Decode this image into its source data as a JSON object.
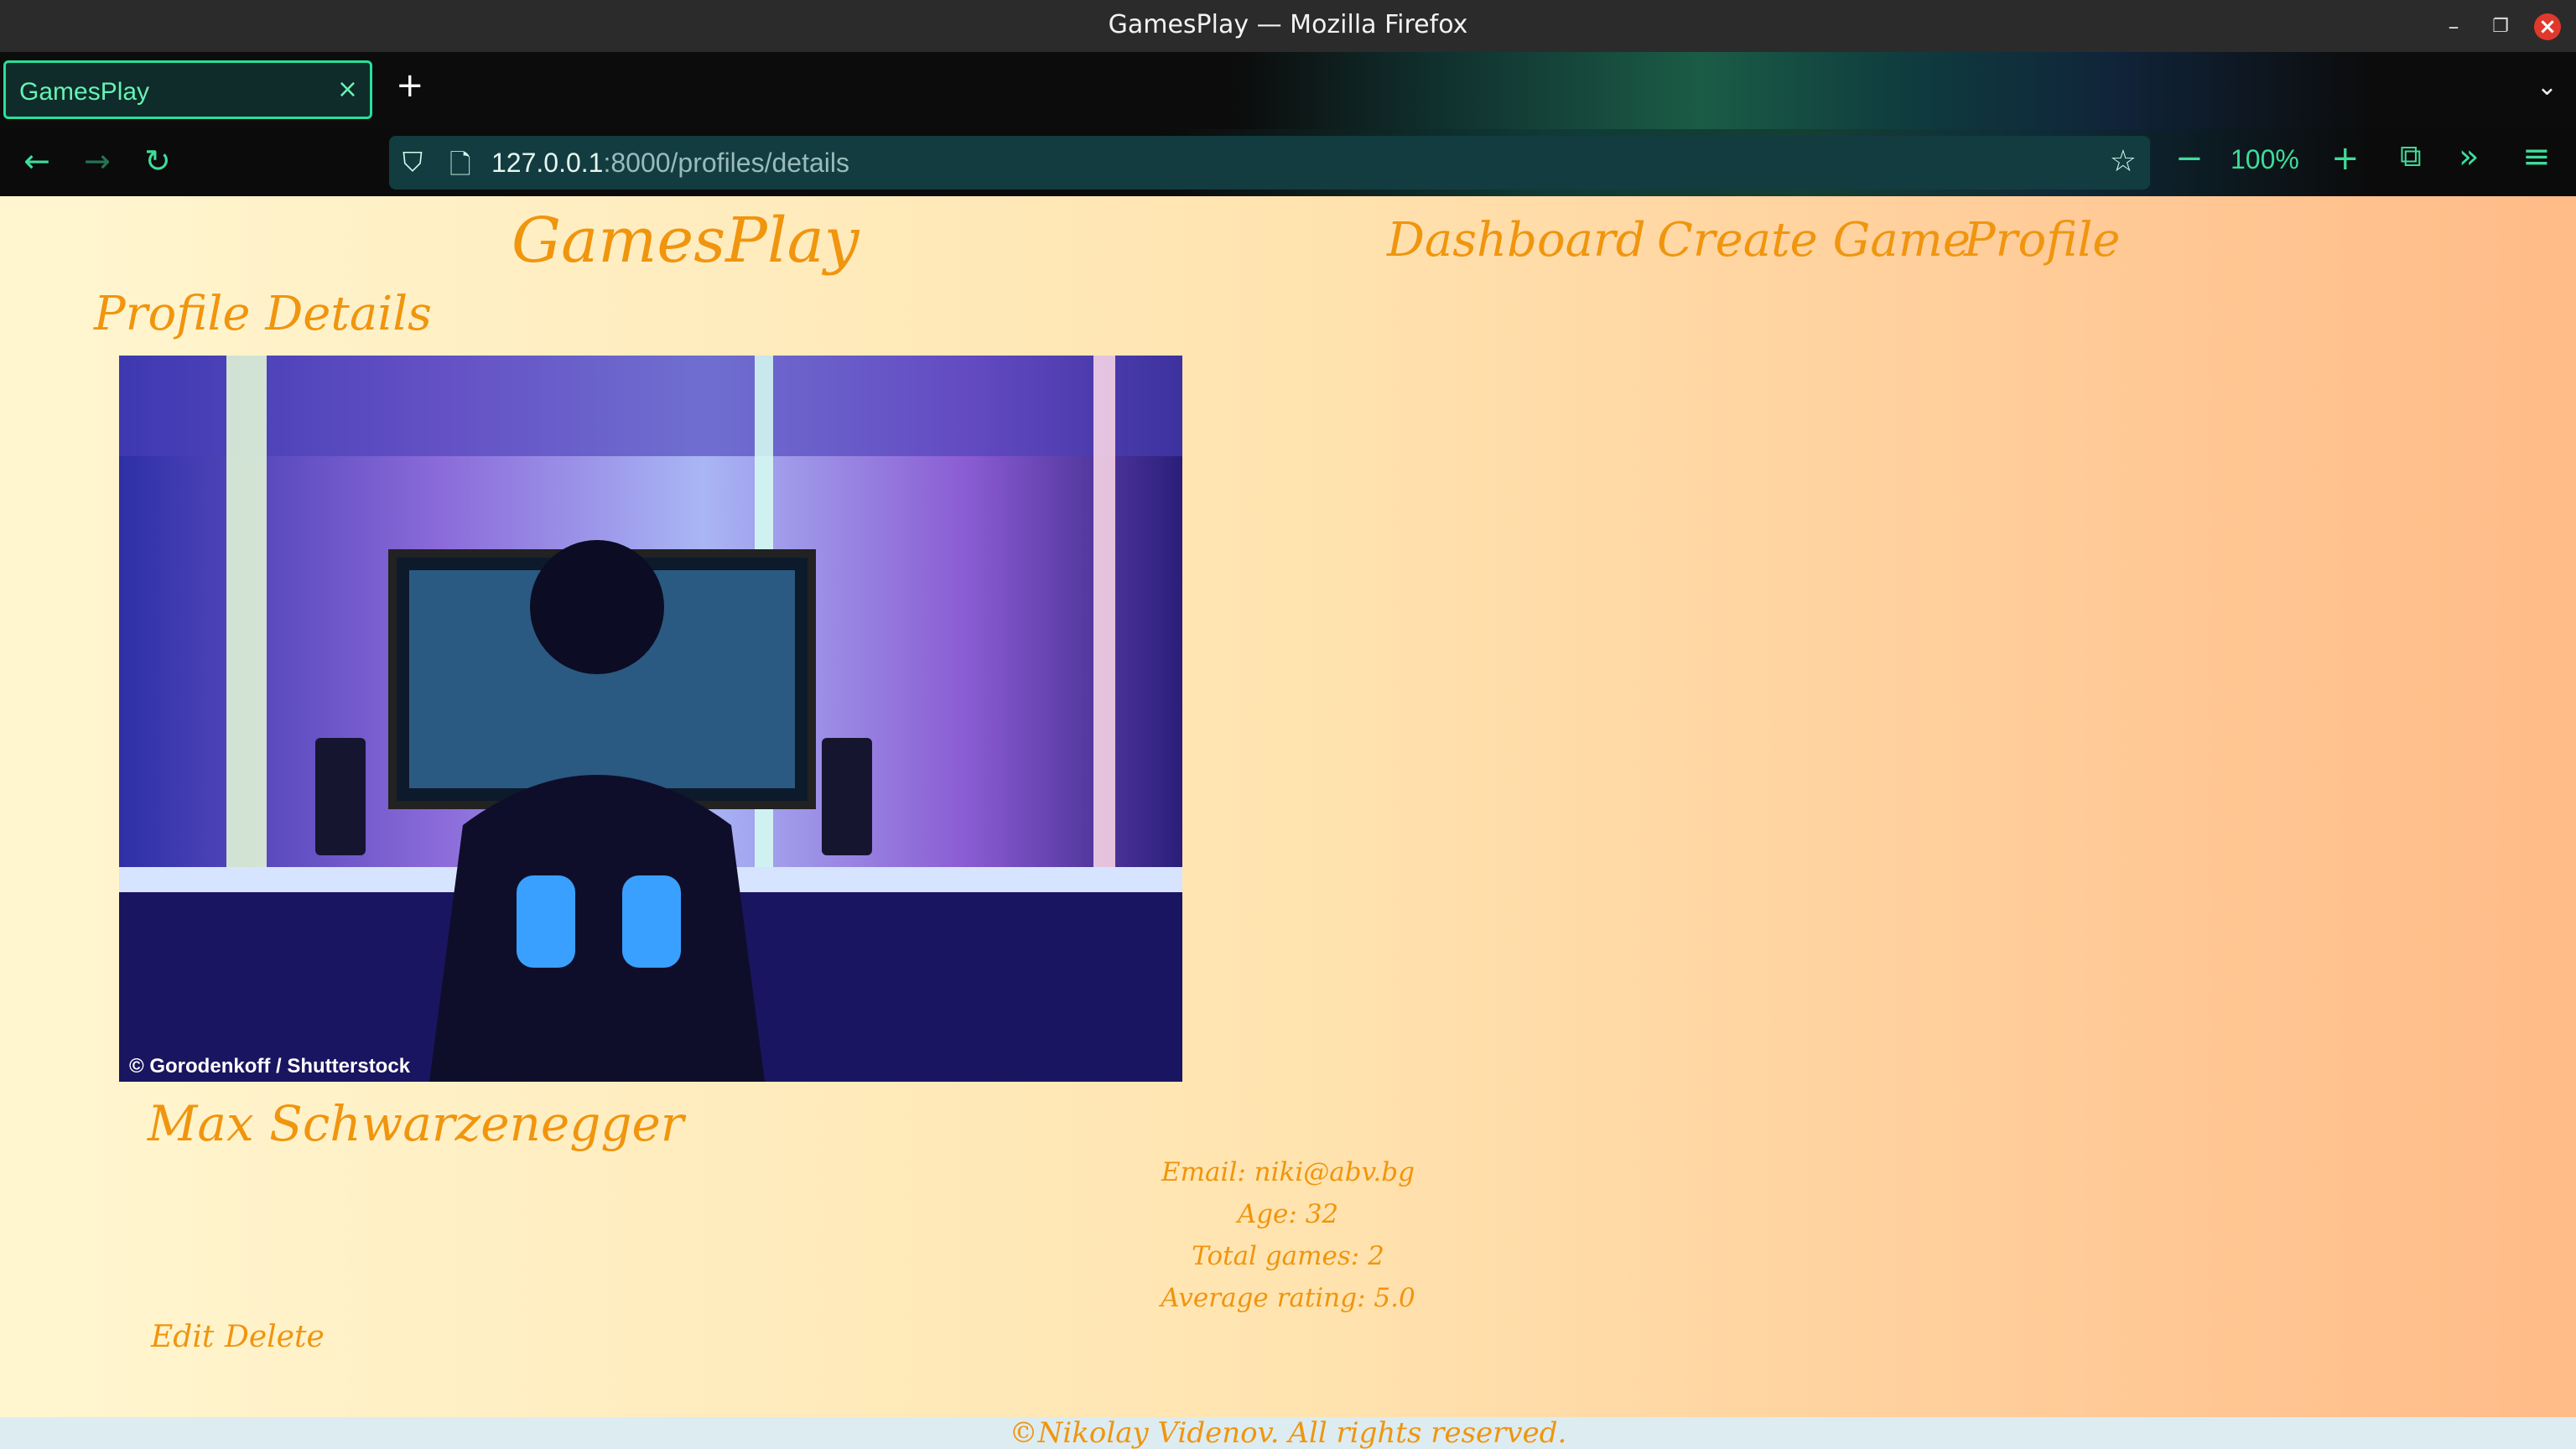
{
  "window": {
    "title": "GamesPlay — Mozilla Firefox"
  },
  "browser": {
    "tab_label": "GamesPlay",
    "url_host": "127.0.0.1",
    "url_path": ":8000/profiles/details",
    "zoom": "100%"
  },
  "site": {
    "logo": "GamesPlay",
    "nav": {
      "dashboard": "Dashboard",
      "create_game": "Create Game",
      "profile": "Profile"
    }
  },
  "profile": {
    "heading": "Profile Details",
    "image_credit": "© Gorodenkoff / Shutterstock",
    "name": "Max Schwarzenegger",
    "email": "Email: niki@abv.bg",
    "age": "Age: 32",
    "total_games": "Total games: 2",
    "average_rating": "Average rating: 5.0",
    "actions": {
      "edit": "Edit",
      "delete": "Delete"
    }
  },
  "footer": {
    "text": "©Nikolay Videnov. All rights reserved."
  },
  "colors": {
    "accent": "#f0950e",
    "firefox_accent": "#3fdc9a"
  },
  "icons": [
    "back-icon",
    "forward-icon",
    "reload-icon",
    "shield-icon",
    "page-icon",
    "bookmark-star-icon",
    "zoom-out-icon",
    "zoom-in-icon",
    "extensions-icon",
    "overflow-icon",
    "menu-icon"
  ]
}
